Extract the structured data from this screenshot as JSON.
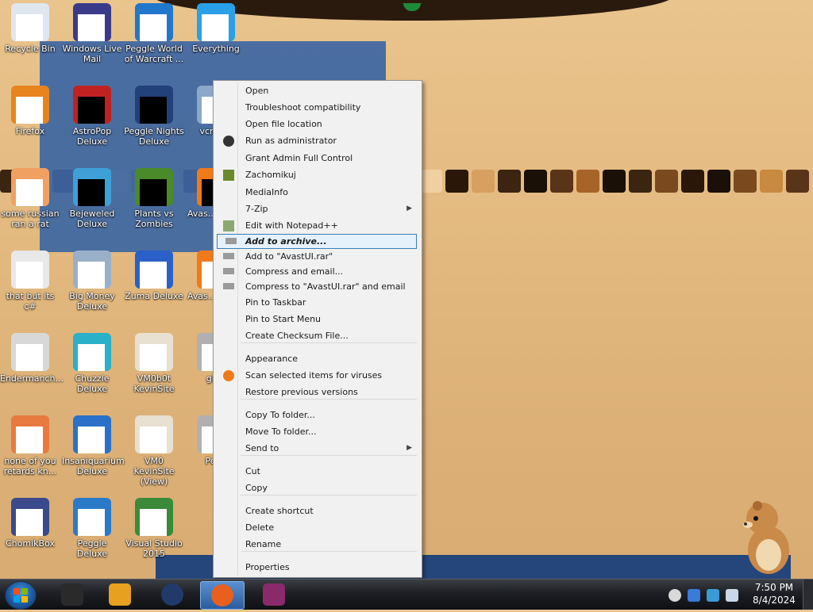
{
  "desktop": {
    "icons": [
      {
        "label": "Recycle Bin",
        "icon": "recycle-bin-icon",
        "color": "#dfe6ee"
      },
      {
        "label": "Windows Live Mail",
        "icon": "mail-icon",
        "color": "#3a3a8a"
      },
      {
        "label": "Peggle World of Warcraft ...",
        "icon": "peggle-icon",
        "color": "#2277cc"
      },
      {
        "label": "Everything",
        "icon": "search-icon",
        "color": "#2aa0e8"
      },
      {
        "label": "Firefox",
        "icon": "firefox-icon",
        "color": "#e8841e"
      },
      {
        "label": "AstroPop Deluxe",
        "icon": "astropop-icon",
        "color": "#c02222"
      },
      {
        "label": "Peggle Nights Deluxe",
        "icon": "peggle-icon",
        "color": "#22407a"
      },
      {
        "label": "vcred...",
        "icon": "installer-icon",
        "color": "#8aa8c8"
      },
      {
        "label": "some russian ran a rat",
        "icon": "document-icon",
        "color": "#f0a060"
      },
      {
        "label": "Bejeweled Deluxe",
        "icon": "gem-icon",
        "color": "#3fa0d8"
      },
      {
        "label": "Plants vs Zombies",
        "icon": "plant-icon",
        "color": "#4a8a2a"
      },
      {
        "label": "Avas... Anti...",
        "icon": "avast-icon",
        "color": "#f07a1a"
      },
      {
        "label": "that but its c#",
        "icon": "files-icon",
        "color": "#e8e8e8"
      },
      {
        "label": "Big Money Deluxe",
        "icon": "money-icon",
        "color": "#9ab0c8"
      },
      {
        "label": "Zuma Deluxe",
        "icon": "zuma-icon",
        "color": "#2a60c8"
      },
      {
        "label": "Avas... Anti...",
        "icon": "avast-icon",
        "color": "#f07a1a"
      },
      {
        "label": "Endermanch...",
        "icon": "window-icon",
        "color": "#d8d8d8"
      },
      {
        "label": "Chuzzle Deluxe",
        "icon": "chuzzle-icon",
        "color": "#2ab0c8"
      },
      {
        "label": "VM0b0t KevinSite",
        "icon": "shortcut-icon",
        "color": "#e8e0d0"
      },
      {
        "label": "gh...",
        "icon": "app-icon",
        "color": "#b0b0b0"
      },
      {
        "label": "none of you retards kn...",
        "icon": "document-icon",
        "color": "#e87a40"
      },
      {
        "label": "Insaniquarium Deluxe",
        "icon": "fish-icon",
        "color": "#2a70c8"
      },
      {
        "label": "VM0 KevinSite (View)",
        "icon": "shortcut-icon",
        "color": "#e8e0d0"
      },
      {
        "label": "Per...",
        "icon": "app-icon",
        "color": "#b0b0b0"
      },
      {
        "label": "ChomikBox",
        "icon": "chomikbox-icon",
        "color": "#3a4a8a"
      },
      {
        "label": "Peggle Deluxe",
        "icon": "peggle-icon",
        "color": "#2a7ac8"
      },
      {
        "label": "Visual Studio 2015",
        "icon": "visual-studio-icon",
        "color": "#3a8a3a"
      }
    ]
  },
  "context_menu": {
    "items": [
      {
        "label": "Open",
        "icon": ""
      },
      {
        "label": "Troubleshoot compatibility",
        "icon": ""
      },
      {
        "label": "Open file location",
        "icon": ""
      },
      {
        "label": "Run as administrator",
        "icon": "shield-icon"
      },
      {
        "label": "Grant Admin Full Control",
        "icon": ""
      },
      {
        "label": "Zachomikuj",
        "icon": "chomik-icon"
      },
      {
        "label": "MediaInfo",
        "icon": ""
      },
      {
        "label": "7-Zip",
        "icon": "",
        "submenu": true
      },
      {
        "label": "Edit with Notepad++",
        "icon": "notepad-icon"
      },
      {
        "label": "Add to archive...",
        "icon": "archive-icon",
        "highlighted": true
      },
      {
        "label": "Add to \"AvastUI.rar\"",
        "icon": "archive-icon"
      },
      {
        "label": "Compress and email...",
        "icon": "archive-icon"
      },
      {
        "label": "Compress to \"AvastUI.rar\" and email",
        "icon": "archive-icon"
      },
      {
        "label": "Pin to Taskbar",
        "icon": ""
      },
      {
        "label": "Pin to Start Menu",
        "icon": ""
      },
      {
        "label": "Create Checksum File...",
        "icon": ""
      },
      {
        "label": "Appearance",
        "icon": ""
      },
      {
        "label": "Scan selected items for viruses",
        "icon": "avast-icon"
      },
      {
        "label": "Restore previous versions",
        "icon": ""
      },
      {
        "label": "Copy To folder...",
        "icon": ""
      },
      {
        "label": "Move To folder...",
        "icon": ""
      },
      {
        "label": "Send to",
        "icon": "",
        "submenu": true
      },
      {
        "label": "Cut",
        "icon": ""
      },
      {
        "label": "Copy",
        "icon": ""
      },
      {
        "label": "Create shortcut",
        "icon": ""
      },
      {
        "label": "Delete",
        "icon": ""
      },
      {
        "label": "Rename",
        "icon": ""
      },
      {
        "label": "Properties",
        "icon": ""
      }
    ]
  },
  "taskbar": {
    "start_icon": "windows-start-icon",
    "pinned": [
      {
        "icon": "explorer-icon",
        "color": "#2a2a2a",
        "active": false
      },
      {
        "icon": "media-player-icon",
        "color": "#e8a020",
        "active": false
      },
      {
        "icon": "world-icon",
        "color": "#223a6a",
        "active": false
      },
      {
        "icon": "firefox-icon",
        "color": "#e8601e",
        "active": true
      },
      {
        "icon": "winrar-icon",
        "color": "#8a2a6a",
        "active": false
      }
    ],
    "tray_icons": [
      "show-hidden-icons-icon",
      "security-icon",
      "network-icon",
      "volume-icon"
    ],
    "clock": {
      "time": "7:50 PM",
      "date": "8/4/2024"
    }
  },
  "colors": {
    "desktop_background": "#e3b97f",
    "selection": "#3d66a3",
    "menu_highlight": "#e5f1fb",
    "menu_highlight_border": "#3c7fb1"
  }
}
